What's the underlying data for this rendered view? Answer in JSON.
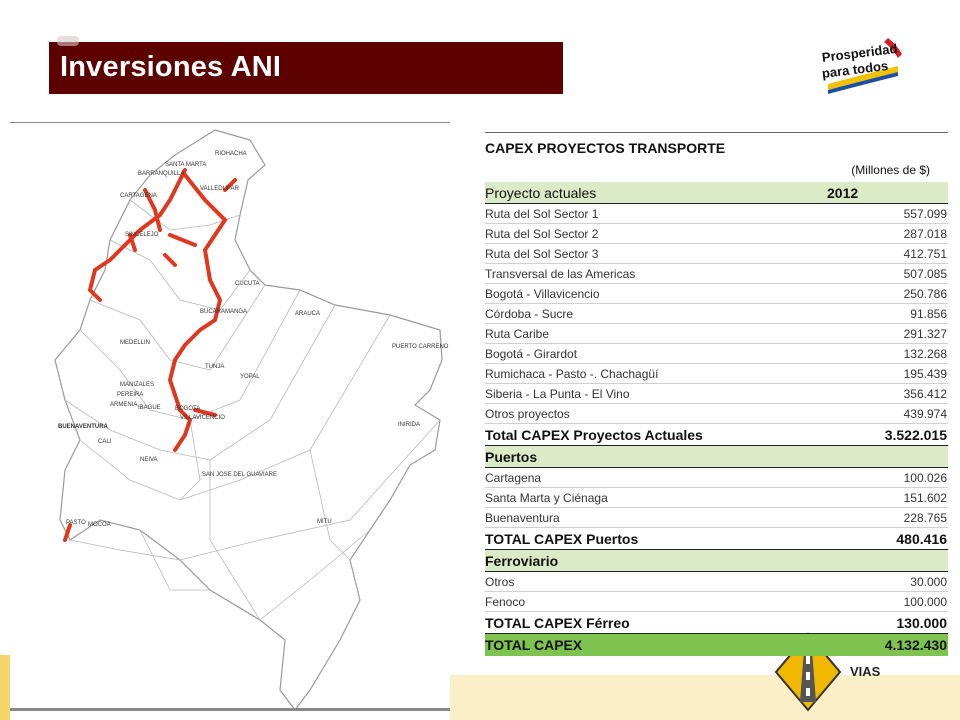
{
  "header": {
    "title": "Inversiones ANI"
  },
  "logo": {
    "line1": "Prosperidad",
    "line2": "para todos"
  },
  "sign": {
    "text": "VIAS"
  },
  "map": {
    "labels": [
      "RIOHACHA",
      "SANTA MARTA",
      "BARRANQUILLA",
      "VALLEDUPAR",
      "CARTAGENA",
      "SINCELEJO",
      "CUCUTA",
      "BUCARAMANGA",
      "ARAUCA",
      "MEDELLIN",
      "PUERTO CARRENO",
      "TUNJA",
      "YOPAL",
      "MANIZALES",
      "PEREIRA",
      "ARMENIA",
      "IBAGUE",
      "BOGOTA",
      "VILLAVICENCIO",
      "BUENAVENTURA",
      "CALI",
      "INIRIDA",
      "NEIVA",
      "SAN JOSE DEL GUAVIARE",
      "MITU",
      "PASTO",
      "MOCOA"
    ]
  },
  "table": {
    "title": "CAPEX PROYECTOS TRANSPORTE",
    "unit": "(Millones de $)",
    "col_project": "Proyecto actuales",
    "col_year": "2012",
    "rows": [
      {
        "name": "Ruta del Sol Sector 1",
        "value": "557.099"
      },
      {
        "name": "Ruta del Sol Sector 2",
        "value": "287.018"
      },
      {
        "name": "Ruta del Sol Sector 3",
        "value": "412.751"
      },
      {
        "name": "Transversal de las Americas",
        "value": "507.085"
      },
      {
        "name": "Bogotá - Villavicencio",
        "value": "250.786"
      },
      {
        "name": "Córdoba - Sucre",
        "value": "91.856"
      },
      {
        "name": "Ruta Caribe",
        "value": "291.327"
      },
      {
        "name": "Bogotá - Girardot",
        "value": "132.268"
      },
      {
        "name": "Rumichaca - Pasto -. Chachagüí",
        "value": "195.439"
      },
      {
        "name": "Siberia - La Punta - El Vino",
        "value": "356.412"
      },
      {
        "name": "Otros proyectos",
        "value": "439.974"
      }
    ],
    "total_actuales": {
      "label": "Total CAPEX Proyectos Actuales",
      "value": "3.522.015"
    },
    "puertos": {
      "label": "Puertos",
      "rows": [
        {
          "name": "Cartagena",
          "value": "100.026"
        },
        {
          "name": "Santa Marta y Ciénaga",
          "value": "151.602"
        },
        {
          "name": "Buenaventura",
          "value": "228.765"
        }
      ],
      "total": {
        "label": "TOTAL CAPEX Puertos",
        "value": "480.416"
      }
    },
    "ferroviario": {
      "label": "Ferroviario",
      "rows": [
        {
          "name": "Otros",
          "value": "30.000"
        },
        {
          "name": "Fenoco",
          "value": "100.000"
        }
      ],
      "total": {
        "label": "TOTAL CAPEX Férreo",
        "value": "130.000"
      }
    },
    "grand_total": {
      "label": "TOTAL CAPEX",
      "value": "4.132.430"
    }
  }
}
